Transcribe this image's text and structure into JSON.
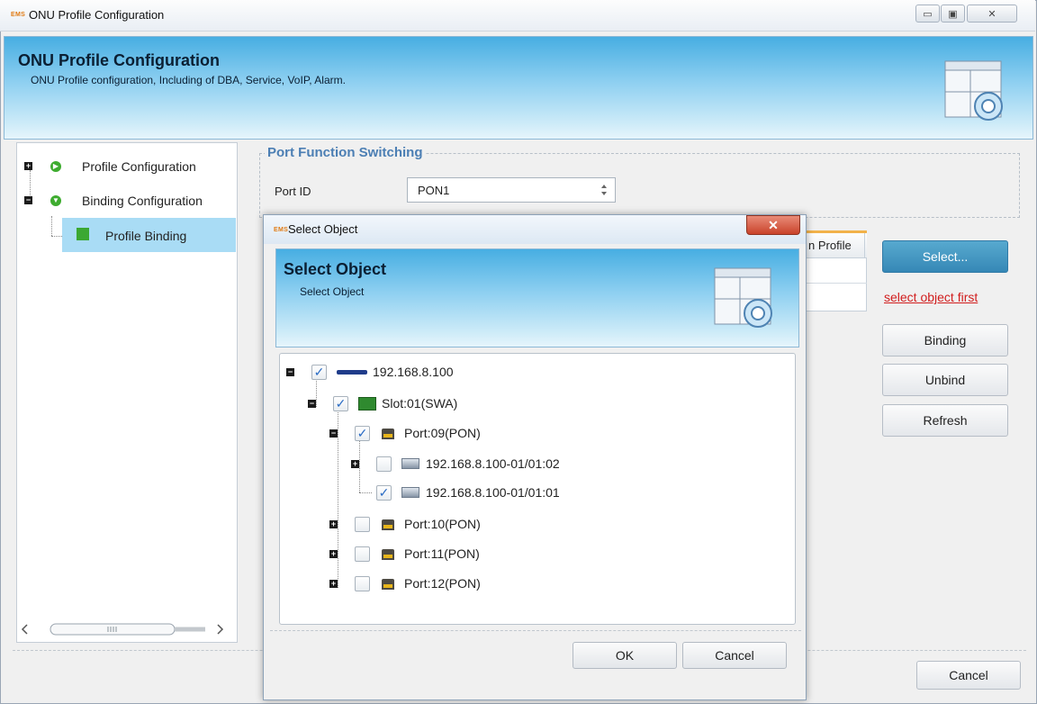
{
  "window": {
    "logo": "EMS",
    "title": "ONU Profile Configuration",
    "controls": {
      "minimize": "▭",
      "maximize": "▣",
      "close": "✕"
    }
  },
  "header": {
    "title": "ONU Profile Configuration",
    "description": "ONU Profile configuration, Including of DBA, Service, VoIP, Alarm."
  },
  "nav_tree": {
    "items": [
      {
        "label": "Profile Configuration",
        "expander": "+"
      },
      {
        "label": "Binding Configuration",
        "expander": "−"
      },
      {
        "label": "Profile Binding"
      }
    ]
  },
  "port_function": {
    "group_title": "Port Function Switching",
    "port_id_label": "Port ID",
    "port_id_value": "PON1"
  },
  "background_table": {
    "partial_header": "n Profile"
  },
  "actions": {
    "select": "Select...",
    "warning": "select object first",
    "binding": "Binding",
    "unbind": "Unbind",
    "refresh": "Refresh",
    "cancel": "Cancel"
  },
  "dialog": {
    "logo": "EMS",
    "window_title": "Select Object",
    "close": "✕",
    "banner_title": "Select Object",
    "banner_desc": "Select Object",
    "tree": [
      {
        "label": "192.168.8.100",
        "checked": true
      },
      {
        "label": "Slot:01(SWA)",
        "checked": true
      },
      {
        "label": "Port:09(PON)",
        "checked": true
      },
      {
        "label": "192.168.8.100-01/01:02",
        "checked": false
      },
      {
        "label": "192.168.8.100-01/01:01",
        "checked": true
      },
      {
        "label": "Port:10(PON)",
        "checked": false
      },
      {
        "label": "Port:11(PON)",
        "checked": false
      },
      {
        "label": "Port:12(PON)",
        "checked": false
      }
    ],
    "ok": "OK",
    "cancel": "Cancel"
  }
}
